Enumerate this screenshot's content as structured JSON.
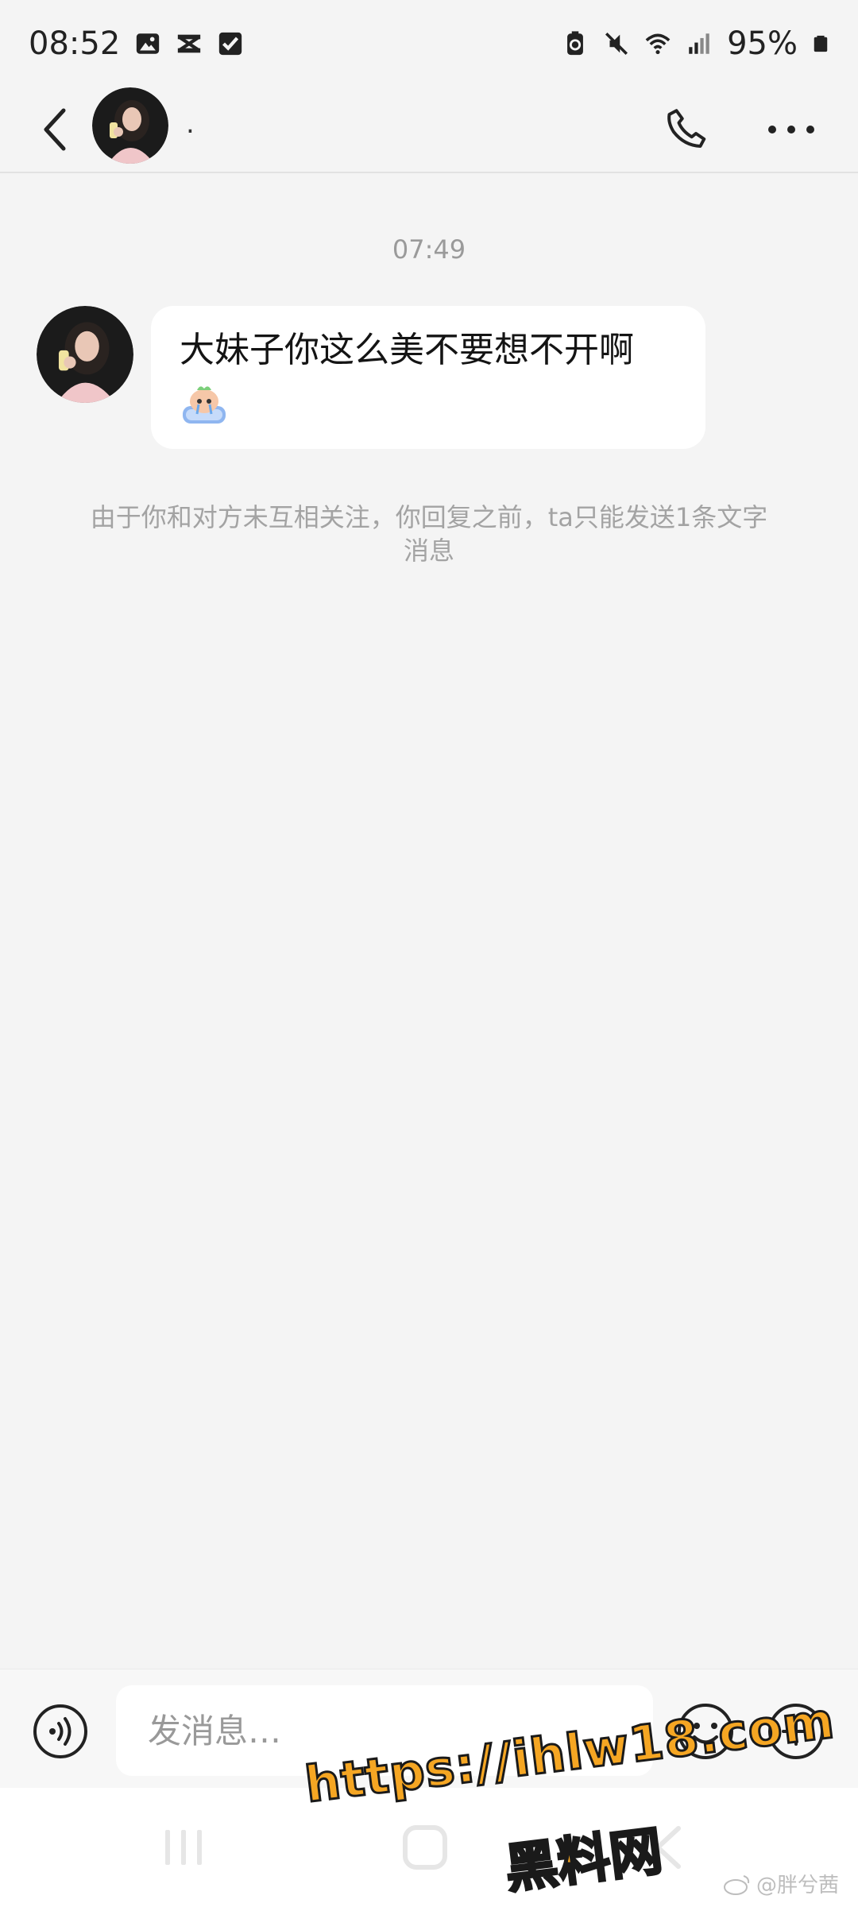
{
  "status_bar": {
    "time": "08:52",
    "battery": "95%",
    "icons": [
      "gallery-icon",
      "capcut-icon",
      "check-icon",
      "battery-saver-icon",
      "mute-icon",
      "wifi-icon",
      "signal-icon",
      "battery-icon"
    ]
  },
  "header": {
    "contact_name": ".",
    "back_icon": "chevron-left-icon",
    "call_icon": "phone-icon",
    "more_icon": "more-dots-icon"
  },
  "chat": {
    "timestamp": "07:49",
    "message_text": "大妹子你这么美不要想不开啊",
    "sticker": "crying-sticker",
    "notice": "由于你和对方未互相关注，你回复之前，ta只能发送1条文字消息"
  },
  "input_bar": {
    "placeholder": "发消息…",
    "voice_icon": "voice-icon",
    "emoji_icon": "emoji-icon",
    "plus_icon": "plus-icon"
  },
  "watermark": {
    "url": "https://ihlw18.com",
    "text": "黑料网",
    "weibo": "@胖兮茜"
  },
  "colors": {
    "background": "#f4f4f4",
    "bubble": "#ffffff",
    "watermark": "#f5a623",
    "muted_text": "#a3a3a3"
  }
}
